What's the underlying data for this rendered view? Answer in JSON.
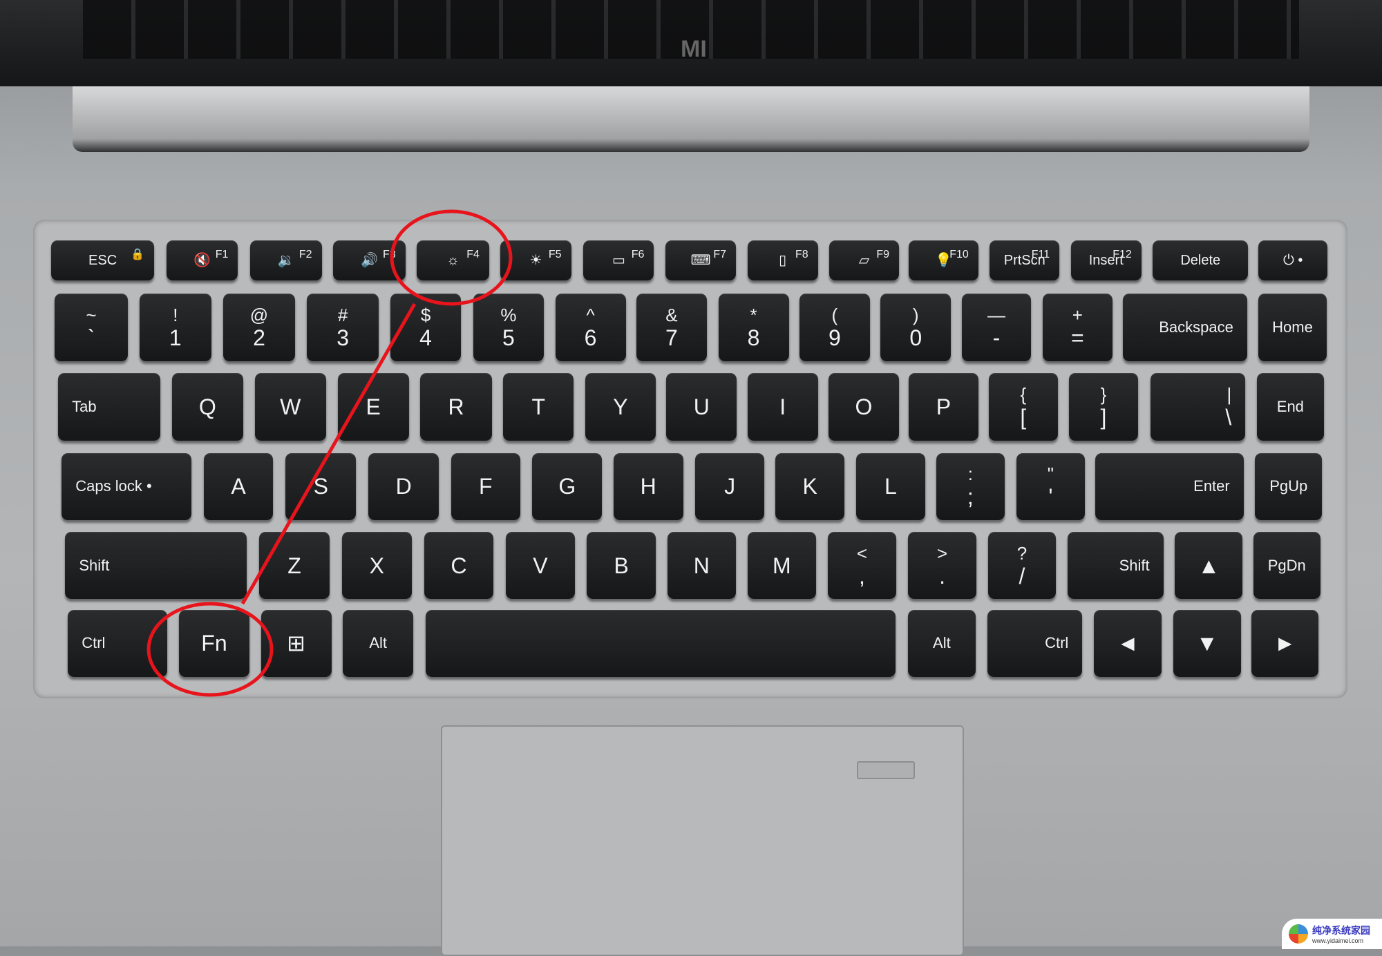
{
  "brand_logo": "MI",
  "keyboard": {
    "rows": [
      [
        {
          "m": "ESC",
          "t": "🔒"
        },
        {
          "m": "🔇",
          "t": "F1"
        },
        {
          "m": "🔉",
          "t": "F2"
        },
        {
          "m": "🔊",
          "t": "F3"
        },
        {
          "m": "☼",
          "t": "F4"
        },
        {
          "m": "☀",
          "t": "F5"
        },
        {
          "m": "▭",
          "t": "F6"
        },
        {
          "m": "⌨",
          "t": "F7"
        },
        {
          "m": "▯",
          "t": "F8"
        },
        {
          "m": "▱",
          "t": "F9"
        },
        {
          "m": "💡",
          "t": "F10"
        },
        {
          "m": "PrtScn",
          "t": "F11"
        },
        {
          "m": "Insert",
          "t": "F12"
        },
        {
          "m": "Delete"
        },
        {
          "m": "⏻ •"
        }
      ],
      [
        {
          "t": "~",
          "m": "`"
        },
        {
          "t": "!",
          "m": "1"
        },
        {
          "t": "@",
          "m": "2"
        },
        {
          "t": "#",
          "m": "3"
        },
        {
          "t": "$",
          "m": "4"
        },
        {
          "t": "%",
          "m": "5"
        },
        {
          "t": "^",
          "m": "6"
        },
        {
          "t": "&",
          "m": "7"
        },
        {
          "t": "*",
          "m": "8"
        },
        {
          "t": "(",
          "m": "9"
        },
        {
          "t": ")",
          "m": "0"
        },
        {
          "t": "—",
          "m": "-"
        },
        {
          "t": "+",
          "m": "="
        },
        {
          "m": "Backspace"
        },
        {
          "m": "Home"
        }
      ],
      [
        {
          "m": "Tab"
        },
        {
          "m": "Q"
        },
        {
          "m": "W"
        },
        {
          "m": "E"
        },
        {
          "m": "R"
        },
        {
          "m": "T"
        },
        {
          "m": "Y"
        },
        {
          "m": "U"
        },
        {
          "m": "I"
        },
        {
          "m": "O"
        },
        {
          "m": "P"
        },
        {
          "t": "{",
          "m": "["
        },
        {
          "t": "}",
          "m": "]"
        },
        {
          "t": "|",
          "m": "\\"
        },
        {
          "m": "End"
        }
      ],
      [
        {
          "m": "Caps lock  •"
        },
        {
          "m": "A"
        },
        {
          "m": "S"
        },
        {
          "m": "D"
        },
        {
          "m": "F"
        },
        {
          "m": "G"
        },
        {
          "m": "H"
        },
        {
          "m": "J"
        },
        {
          "m": "K"
        },
        {
          "m": "L"
        },
        {
          "t": ":",
          "m": ";"
        },
        {
          "t": "\"",
          "m": "'"
        },
        {
          "m": "Enter"
        },
        {
          "m": "PgUp"
        }
      ],
      [
        {
          "m": "Shift"
        },
        {
          "m": "Z"
        },
        {
          "m": "X"
        },
        {
          "m": "C"
        },
        {
          "m": "V"
        },
        {
          "m": "B"
        },
        {
          "m": "N"
        },
        {
          "m": "M"
        },
        {
          "t": "<",
          "m": ","
        },
        {
          "t": ">",
          "m": "."
        },
        {
          "t": "?",
          "m": "/"
        },
        {
          "m": "Shift"
        },
        {
          "m": "▲"
        },
        {
          "m": "PgDn"
        }
      ],
      [
        {
          "m": "Ctrl"
        },
        {
          "m": "Fn"
        },
        {
          "m": "⊞"
        },
        {
          "m": "Alt"
        },
        {
          "m": ""
        },
        {
          "m": "Alt"
        },
        {
          "m": "Ctrl"
        },
        {
          "m": "◄"
        },
        {
          "m": "▼"
        },
        {
          "m": "►"
        }
      ]
    ]
  },
  "annotation": {
    "color": "#e8141c",
    "highlighted_keys": [
      "F4",
      "Fn"
    ]
  },
  "watermark": {
    "title": "纯净系统家园",
    "url": "www.yidaimei.com"
  }
}
